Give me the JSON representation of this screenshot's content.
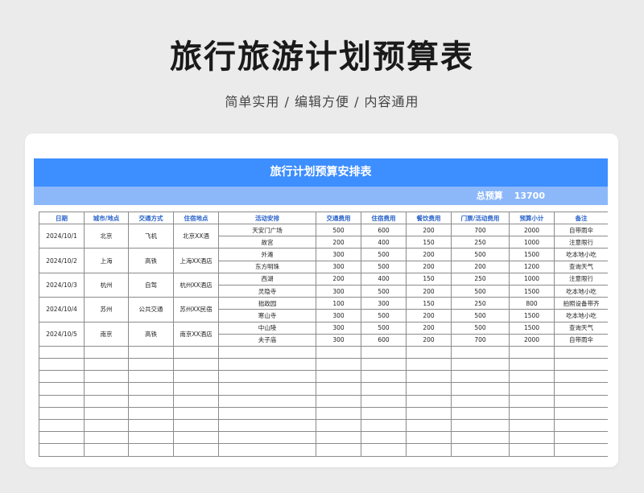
{
  "header": {
    "title": "旅行旅游计划预算表",
    "subtitle": "简单实用 / 编辑方便 / 内容通用"
  },
  "sheet": {
    "title": "旅行计划预算安排表",
    "budget_label": "总预算",
    "budget_value": "13700",
    "columns": [
      "日期",
      "城市/地点",
      "交通方式",
      "住宿地点",
      "活动安排",
      "交通费用",
      "住宿费用",
      "餐饮费用",
      "门票/活动费用",
      "预算小计",
      "备注"
    ],
    "groups": [
      {
        "date": "2024/10/1",
        "city": "北京",
        "transport": "飞机",
        "lodging": "北京XX酒",
        "rows": [
          {
            "activity": "天安门广场",
            "transport_cost": "500",
            "lodging_cost": "600",
            "food_cost": "200",
            "ticket_cost": "700",
            "subtotal": "2000",
            "note": "自带雨伞"
          },
          {
            "activity": "故宫",
            "transport_cost": "200",
            "lodging_cost": "400",
            "food_cost": "150",
            "ticket_cost": "250",
            "subtotal": "1000",
            "note": "注意限行"
          }
        ]
      },
      {
        "date": "2024/10/2",
        "city": "上海",
        "transport": "高铁",
        "lodging": "上海XX酒店",
        "rows": [
          {
            "activity": "外滩",
            "transport_cost": "300",
            "lodging_cost": "500",
            "food_cost": "200",
            "ticket_cost": "500",
            "subtotal": "1500",
            "note": "吃本地小吃"
          },
          {
            "activity": "东方明珠",
            "transport_cost": "300",
            "lodging_cost": "500",
            "food_cost": "200",
            "ticket_cost": "200",
            "subtotal": "1200",
            "note": "查询天气"
          }
        ]
      },
      {
        "date": "2024/10/3",
        "city": "杭州",
        "transport": "自驾",
        "lodging": "杭州XX酒店",
        "rows": [
          {
            "activity": "西湖",
            "transport_cost": "200",
            "lodging_cost": "400",
            "food_cost": "150",
            "ticket_cost": "250",
            "subtotal": "1000",
            "note": "注意限行"
          },
          {
            "activity": "灵隐寺",
            "transport_cost": "300",
            "lodging_cost": "500",
            "food_cost": "200",
            "ticket_cost": "500",
            "subtotal": "1500",
            "note": "吃本地小吃"
          }
        ]
      },
      {
        "date": "2024/10/4",
        "city": "苏州",
        "transport": "公共交通",
        "lodging": "苏州XX民宿",
        "rows": [
          {
            "activity": "拙政园",
            "transport_cost": "100",
            "lodging_cost": "300",
            "food_cost": "150",
            "ticket_cost": "250",
            "subtotal": "800",
            "note": "拍照设备带齐"
          },
          {
            "activity": "寒山寺",
            "transport_cost": "300",
            "lodging_cost": "500",
            "food_cost": "200",
            "ticket_cost": "500",
            "subtotal": "1500",
            "note": "吃本地小吃"
          }
        ]
      },
      {
        "date": "2024/10/5",
        "city": "南京",
        "transport": "高铁",
        "lodging": "南京XX酒店",
        "rows": [
          {
            "activity": "中山陵",
            "transport_cost": "300",
            "lodging_cost": "500",
            "food_cost": "200",
            "ticket_cost": "500",
            "subtotal": "1500",
            "note": "查询天气"
          },
          {
            "activity": "夫子庙",
            "transport_cost": "300",
            "lodging_cost": "600",
            "food_cost": "200",
            "ticket_cost": "700",
            "subtotal": "2000",
            "note": "自带雨伞"
          }
        ]
      }
    ],
    "empty_rows": 9
  }
}
